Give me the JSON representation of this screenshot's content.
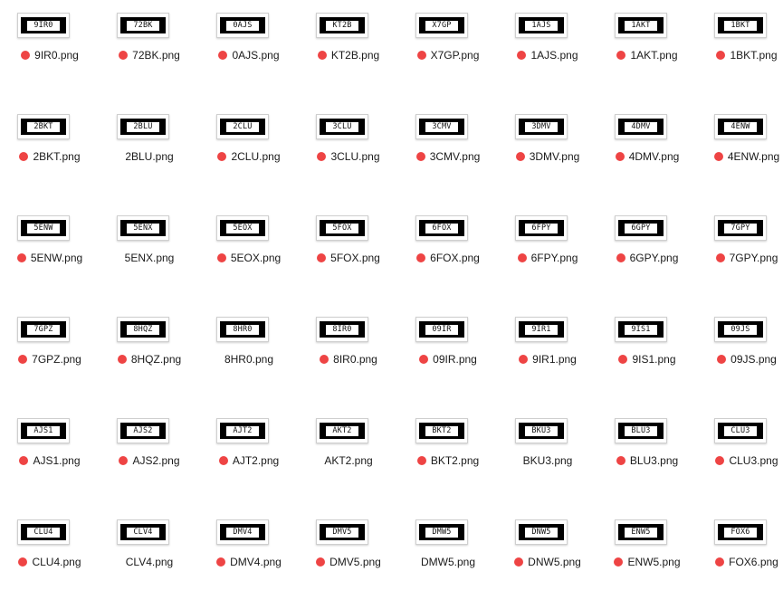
{
  "colors": {
    "background": "#ffffff",
    "tag_red": "#ee4444",
    "plate_black": "#000000",
    "label_text": "#1a1a1a"
  },
  "files": [
    {
      "plate": "9IR0",
      "name": "9IR0.png",
      "tag": true
    },
    {
      "plate": "72BK",
      "name": "72BK.png",
      "tag": true
    },
    {
      "plate": "0AJS",
      "name": "0AJS.png",
      "tag": true
    },
    {
      "plate": "KT2B",
      "name": "KT2B.png",
      "tag": true
    },
    {
      "plate": "X7GP",
      "name": "X7GP.png",
      "tag": true
    },
    {
      "plate": "1AJS",
      "name": "1AJS.png",
      "tag": true
    },
    {
      "plate": "1AKT",
      "name": "1AKT.png",
      "tag": true
    },
    {
      "plate": "1BKT",
      "name": "1BKT.png",
      "tag": true
    },
    {
      "plate": "2BKT",
      "name": "2BKT.png",
      "tag": true
    },
    {
      "plate": "2BLU",
      "name": "2BLU.png",
      "tag": false
    },
    {
      "plate": "2CLU",
      "name": "2CLU.png",
      "tag": true
    },
    {
      "plate": "3CLU",
      "name": "3CLU.png",
      "tag": true
    },
    {
      "plate": "3CMV",
      "name": "3CMV.png",
      "tag": true
    },
    {
      "plate": "3DMV",
      "name": "3DMV.png",
      "tag": true
    },
    {
      "plate": "4DMV",
      "name": "4DMV.png",
      "tag": true
    },
    {
      "plate": "4ENW",
      "name": "4ENW.png",
      "tag": true
    },
    {
      "plate": "5ENW",
      "name": "5ENW.png",
      "tag": true
    },
    {
      "plate": "5ENX",
      "name": "5ENX.png",
      "tag": false
    },
    {
      "plate": "5EOX",
      "name": "5EOX.png",
      "tag": true
    },
    {
      "plate": "5FOX",
      "name": "5FOX.png",
      "tag": true
    },
    {
      "plate": "6FOX",
      "name": "6FOX.png",
      "tag": true
    },
    {
      "plate": "6FPY",
      "name": "6FPY.png",
      "tag": true
    },
    {
      "plate": "6GPY",
      "name": "6GPY.png",
      "tag": true
    },
    {
      "plate": "7GPY",
      "name": "7GPY.png",
      "tag": true
    },
    {
      "plate": "7GPZ",
      "name": "7GPZ.png",
      "tag": true
    },
    {
      "plate": "8HQZ",
      "name": "8HQZ.png",
      "tag": true
    },
    {
      "plate": "8HR0",
      "name": "8HR0.png",
      "tag": false
    },
    {
      "plate": "8IR0",
      "name": "8IR0.png",
      "tag": true
    },
    {
      "plate": "09IR",
      "name": "09IR.png",
      "tag": true
    },
    {
      "plate": "9IR1",
      "name": "9IR1.png",
      "tag": true
    },
    {
      "plate": "9IS1",
      "name": "9IS1.png",
      "tag": true
    },
    {
      "plate": "09JS",
      "name": "09JS.png",
      "tag": true
    },
    {
      "plate": "AJS1",
      "name": "AJS1.png",
      "tag": true
    },
    {
      "plate": "AJS2",
      "name": "AJS2.png",
      "tag": true
    },
    {
      "plate": "AJT2",
      "name": "AJT2.png",
      "tag": true
    },
    {
      "plate": "AKT2",
      "name": "AKT2.png",
      "tag": false
    },
    {
      "plate": "BKT2",
      "name": "BKT2.png",
      "tag": true
    },
    {
      "plate": "BKU3",
      "name": "BKU3.png",
      "tag": false
    },
    {
      "plate": "BLU3",
      "name": "BLU3.png",
      "tag": true
    },
    {
      "plate": "CLU3",
      "name": "CLU3.png",
      "tag": true
    },
    {
      "plate": "CLU4",
      "name": "CLU4.png",
      "tag": true
    },
    {
      "plate": "CLV4",
      "name": "CLV4.png",
      "tag": false
    },
    {
      "plate": "DMV4",
      "name": "DMV4.png",
      "tag": true
    },
    {
      "plate": "DMV5",
      "name": "DMV5.png",
      "tag": true
    },
    {
      "plate": "DMW5",
      "name": "DMW5.png",
      "tag": false
    },
    {
      "plate": "DNW5",
      "name": "DNW5.png",
      "tag": true
    },
    {
      "plate": "ENW5",
      "name": "ENW5.png",
      "tag": true
    },
    {
      "plate": "FOX6",
      "name": "FOX6.png",
      "tag": true
    }
  ]
}
